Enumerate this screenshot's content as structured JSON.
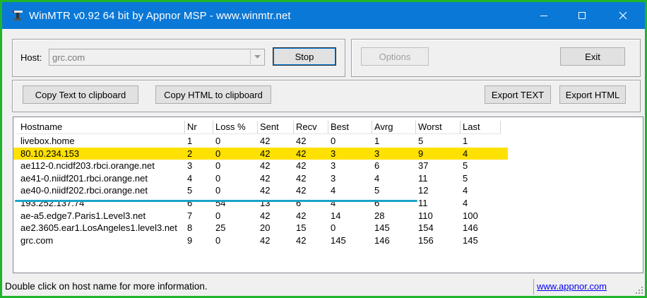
{
  "window": {
    "title": "WinMTR v0.92 64 bit by Appnor MSP - www.winmtr.net",
    "titlebar_color": "#0a78d7",
    "icon": "winmtr-app-icon"
  },
  "controls": {
    "host_label": "Host:",
    "host_value": "grc.com",
    "stop_label": "Stop",
    "options_label": "Options",
    "exit_label": "Exit",
    "copy_text_label": "Copy Text to clipboard",
    "copy_html_label": "Copy HTML to clipboard",
    "export_text_label": "Export TEXT",
    "export_html_label": "Export HTML"
  },
  "table": {
    "columns": [
      "Hostname",
      "Nr",
      "Loss %",
      "Sent",
      "Recv",
      "Best",
      "Avrg",
      "Worst",
      "Last"
    ],
    "highlight_color": "#ffe100",
    "rows": [
      [
        "livebox.home",
        "1",
        "0",
        "42",
        "42",
        "0",
        "1",
        "5",
        "1"
      ],
      [
        "80.10.234.153",
        "2",
        "0",
        "42",
        "42",
        "3",
        "3",
        "9",
        "4"
      ],
      [
        "ae112-0.ncidf203.rbci.orange.net",
        "3",
        "0",
        "42",
        "42",
        "3",
        "6",
        "37",
        "5"
      ],
      [
        "ae41-0.niidf201.rbci.orange.net",
        "4",
        "0",
        "42",
        "42",
        "3",
        "4",
        "11",
        "5"
      ],
      [
        "ae40-0.niidf202.rbci.orange.net",
        "5",
        "0",
        "42",
        "42",
        "4",
        "5",
        "12",
        "4"
      ],
      [
        "193.252.137.74",
        "6",
        "54",
        "13",
        "6",
        "4",
        "6",
        "11",
        "4"
      ],
      [
        "ae-a5.edge7.Paris1.Level3.net",
        "7",
        "0",
        "42",
        "42",
        "14",
        "28",
        "110",
        "100"
      ],
      [
        "ae2.3605.ear1.LosAngeles1.level3.net",
        "8",
        "25",
        "20",
        "15",
        "0",
        "145",
        "154",
        "146"
      ],
      [
        "grc.com",
        "9",
        "0",
        "42",
        "42",
        "145",
        "146",
        "156",
        "145"
      ]
    ],
    "highlighted_row": 1
  },
  "status": {
    "message": "Double click on host name for more information.",
    "link": "www.appnor.com"
  },
  "annotation_line_color": "#1aa3c8"
}
